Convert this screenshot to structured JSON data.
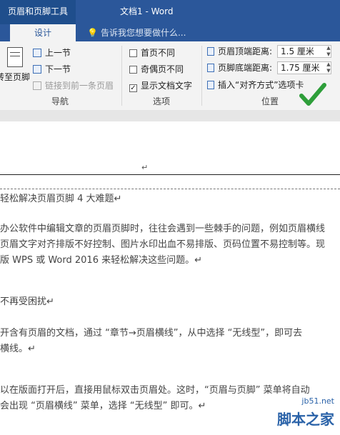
{
  "titlebar": {
    "context_label": "页眉和页脚工具",
    "doc_title": "文档1 - Word"
  },
  "tabs": {
    "design": "设计",
    "tell_me": "告诉我您想要做什么..."
  },
  "ribbon": {
    "navigation": {
      "goto_footer": "转至页脚",
      "prev_section": "上一节",
      "next_section": "下一节",
      "link_to_previous": "链接到前一条页眉",
      "label": "导航"
    },
    "options": {
      "different_first_page": "首页不同",
      "different_first_page_checked": false,
      "different_odd_even": "奇偶页不同",
      "different_odd_even_checked": false,
      "show_doc_text": "显示文档文字",
      "show_doc_text_checked": true,
      "label": "选项"
    },
    "position": {
      "header_from_top_label": "页眉顶端距离:",
      "header_from_top_value": "1.5 厘米",
      "footer_from_bottom_label": "页脚底端距离:",
      "footer_from_bottom_value": "1.75 厘米",
      "insert_align_tab": "插入“对齐方式”选项卡",
      "label": "位置"
    }
  },
  "document": {
    "header_tag": "",
    "lines": [
      "轻松解决页眉页脚 4 大难题↵",
      "办公软件中编辑文章的页眉页脚时，往往会遇到一些棘手的问题，例如页眉横线",
      "页眉文字对齐排版不好控制、图片水印出血不易排版、页码位置不易控制等。现",
      "版 WPS 或 Word 2016 来轻松解决这些问题。↵",
      "不再受困扰↵",
      "开含有页眉的文档，通过 “章节→页眉横线”，从中选择 “无线型”，即可去",
      "横线。↵",
      "以在版面打开后，直接用鼠标双击页眉处。这时，“页眉与页脚” 菜单将自动",
      "会出现 “页眉横线” 菜单，选择 “无线型” 即可。↵"
    ]
  },
  "watermark": {
    "url": "jb51.net",
    "name": "脚本之家"
  },
  "colors": {
    "titlebar": "#2b579a",
    "ribbon": "#f3f3f3",
    "checkmark": "#2e9e3a",
    "watermark": "#2a62a8"
  },
  "icons": [
    "goto-footer-icon",
    "prev-section-icon",
    "next-section-icon",
    "link-to-previous-icon",
    "header-top-icon",
    "footer-bottom-icon",
    "insert-align-tab-icon",
    "lightbulb-icon",
    "green-checkmark-icon"
  ]
}
